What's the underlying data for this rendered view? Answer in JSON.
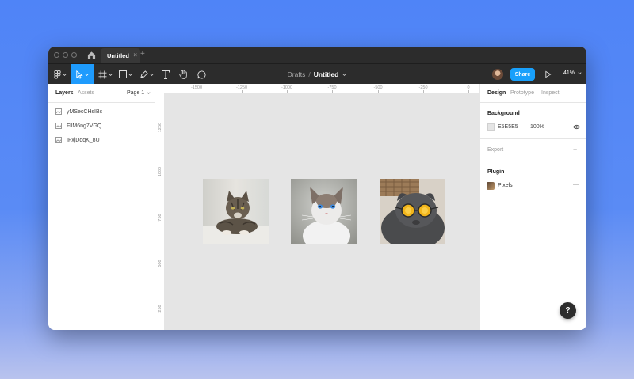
{
  "titlebar": {
    "tab_label": "Untitled",
    "tab_close": "×",
    "new_tab": "+"
  },
  "toolbar": {
    "breadcrumb_parent": "Drafts",
    "breadcrumb_sep": "/",
    "file_name": "Untitled",
    "share_label": "Share",
    "zoom_label": "41%",
    "accent": "#18a0fb"
  },
  "left_panel": {
    "tabs": [
      {
        "label": "Layers"
      },
      {
        "label": "Assets"
      }
    ],
    "page_selector": "Page 1",
    "layers": [
      {
        "label": "yMSecCHsIBc"
      },
      {
        "label": "FllM6ng7VGQ"
      },
      {
        "label": "IFxjDdqK_8U"
      }
    ]
  },
  "rulers": {
    "top": [
      "-1500",
      "-1250",
      "-1000",
      "-750",
      "-500",
      "-250",
      "0"
    ],
    "left": [
      "1250",
      "1000",
      "750",
      "500",
      "250"
    ]
  },
  "canvas": {
    "background": "#E5E5E5",
    "images": [
      {
        "name": "tabby-cat-lying-down"
      },
      {
        "name": "white-cat-blue-eyes-looking-up"
      },
      {
        "name": "gray-cat-yellow-sunglasses"
      }
    ]
  },
  "right_panel": {
    "tabs": [
      {
        "label": "Design"
      },
      {
        "label": "Prototype"
      },
      {
        "label": "Inspect"
      }
    ],
    "background_title": "Background",
    "bg_hex": "E5E5E5",
    "bg_opacity": "100%",
    "export_title": "Export",
    "export_add": "+",
    "plugin_title": "Plugin",
    "plugin_name": "Pixels",
    "plugin_more": "—"
  },
  "help_label": "?"
}
